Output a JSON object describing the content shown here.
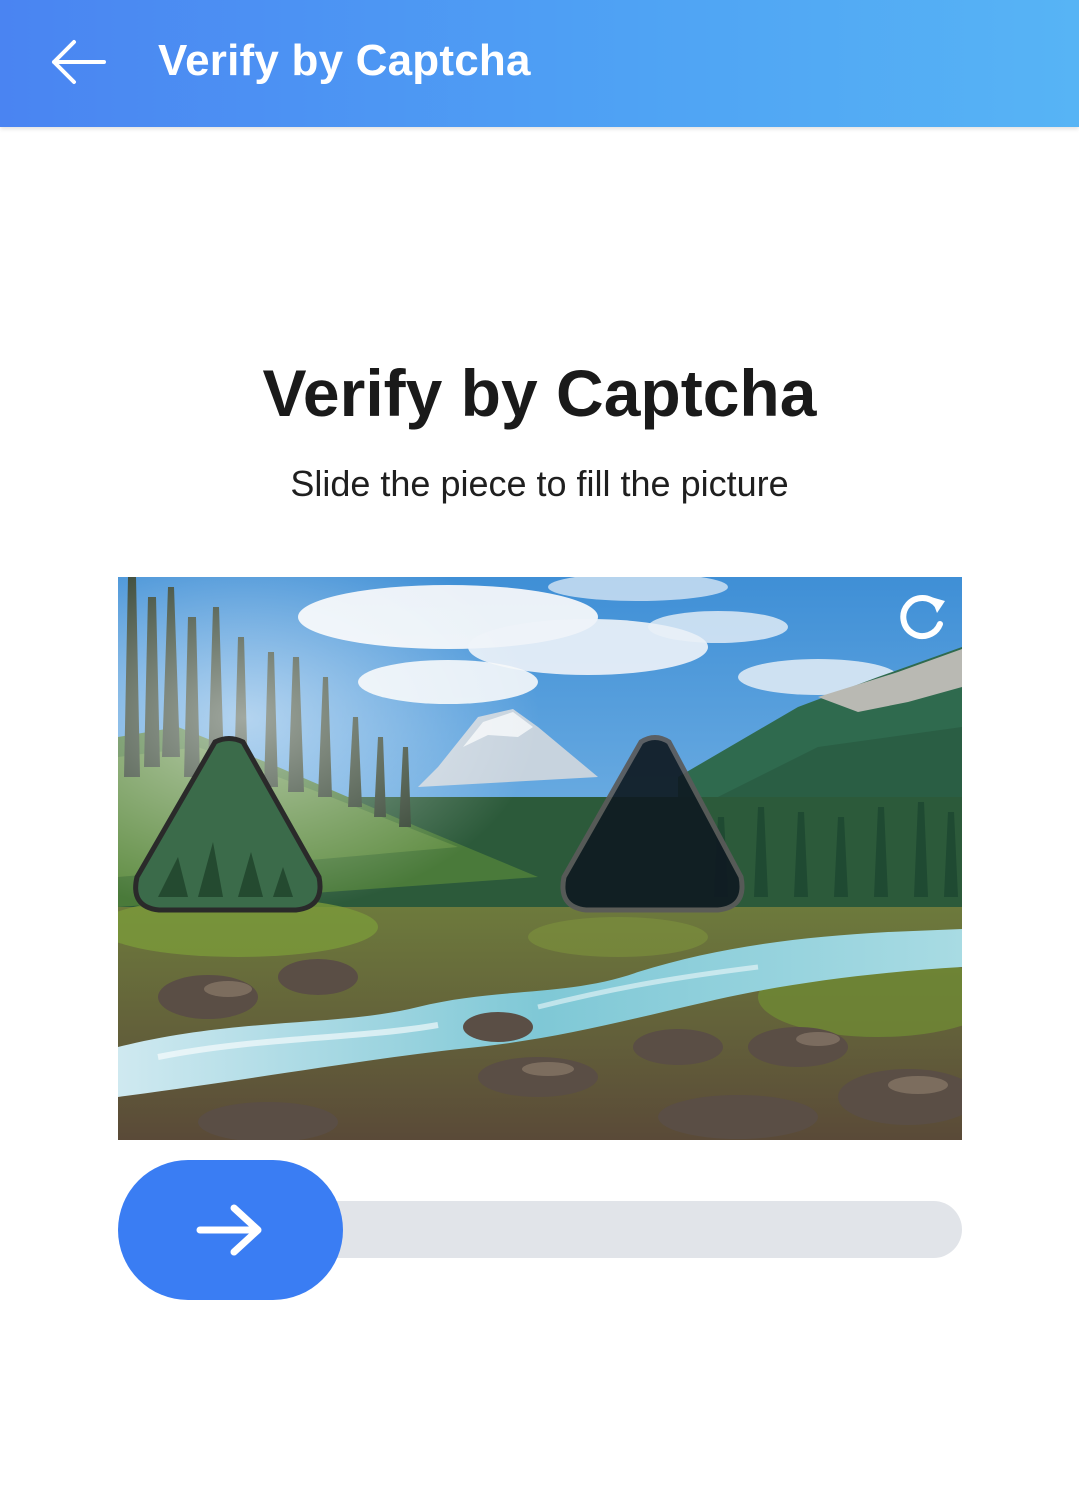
{
  "app_bar": {
    "title": "Verify by Captcha",
    "back_icon": "arrow-left-icon"
  },
  "main": {
    "title": "Verify by Captcha",
    "subtitle": "Slide the piece to fill the picture"
  },
  "captcha": {
    "image_subject": "mountain river valley with pine forest",
    "refresh_icon": "refresh-icon",
    "slider_icon": "arrow-right-icon",
    "slider_progress": 0
  },
  "colors": {
    "app_bar_start": "#4a84f2",
    "app_bar_end": "#57b4f5",
    "accent": "#3a7df3",
    "track": "#e1e4e9"
  }
}
